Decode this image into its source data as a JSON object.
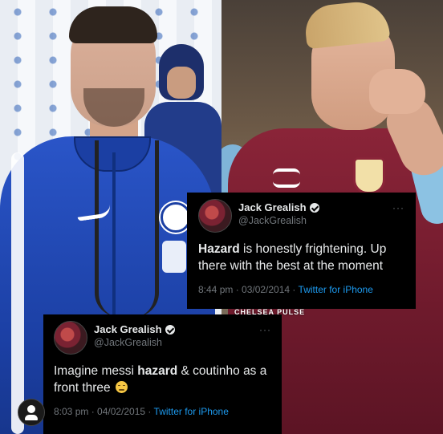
{
  "watermark": "CHELSEA PULSE",
  "tweets": [
    {
      "display_name": "Jack Grealish",
      "handle": "@JackGrealish",
      "text_bold": "Hazard",
      "text_rest": " is honestly frightening. Up there with the best at the moment",
      "time": "8:44 pm · 03/02/2014 · ",
      "source": "Twitter for iPhone"
    },
    {
      "display_name": "Jack Grealish",
      "handle": "@JackGrealish",
      "text_before": "Imagine messi ",
      "text_bold": "hazard",
      "text_after": " & coutinho as a front three",
      "emoji": "crying-face",
      "time": "8:03 pm · 04/02/2015 · ",
      "source": "Twitter for iPhone"
    }
  ]
}
